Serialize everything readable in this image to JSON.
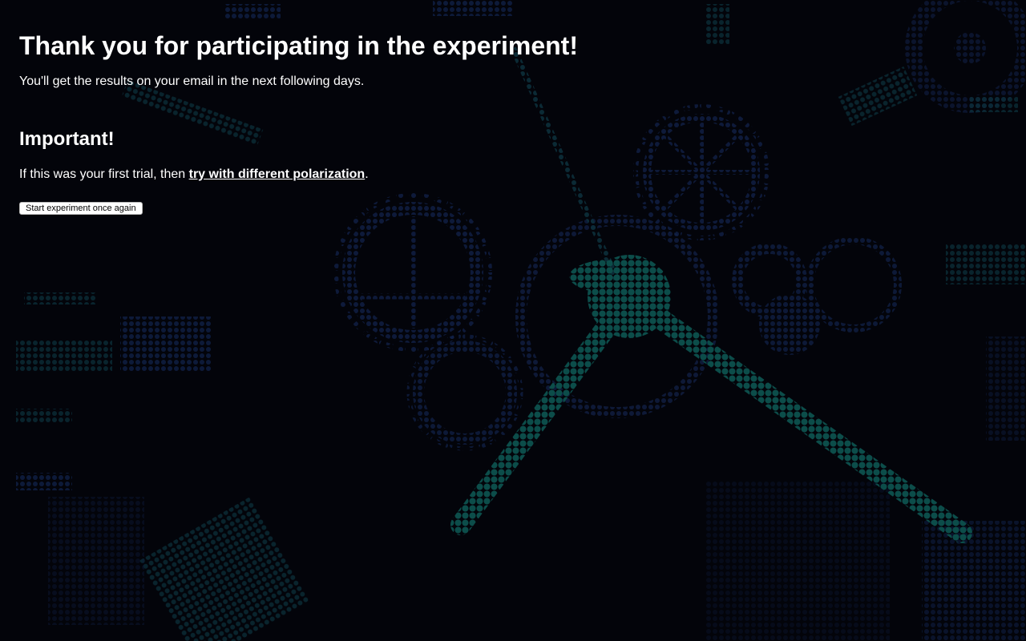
{
  "page": {
    "title": "Thank you for participating in the experiment!",
    "subtitle": "You'll get the results on your email in the next following days.",
    "important_heading": "Important!",
    "note_prefix": "If this was your first trial, then ",
    "note_link": "try with different polarization",
    "note_suffix": ".",
    "restart_button": "Start experiment once again"
  },
  "background": {
    "description_icon": "clockwork-gears-dot-matrix",
    "colors": {
      "base": "#03040a",
      "gear_blue": "#0f1c3f",
      "hand_teal": "#0b4a47",
      "glow_teal": "#0e3a3c"
    }
  }
}
